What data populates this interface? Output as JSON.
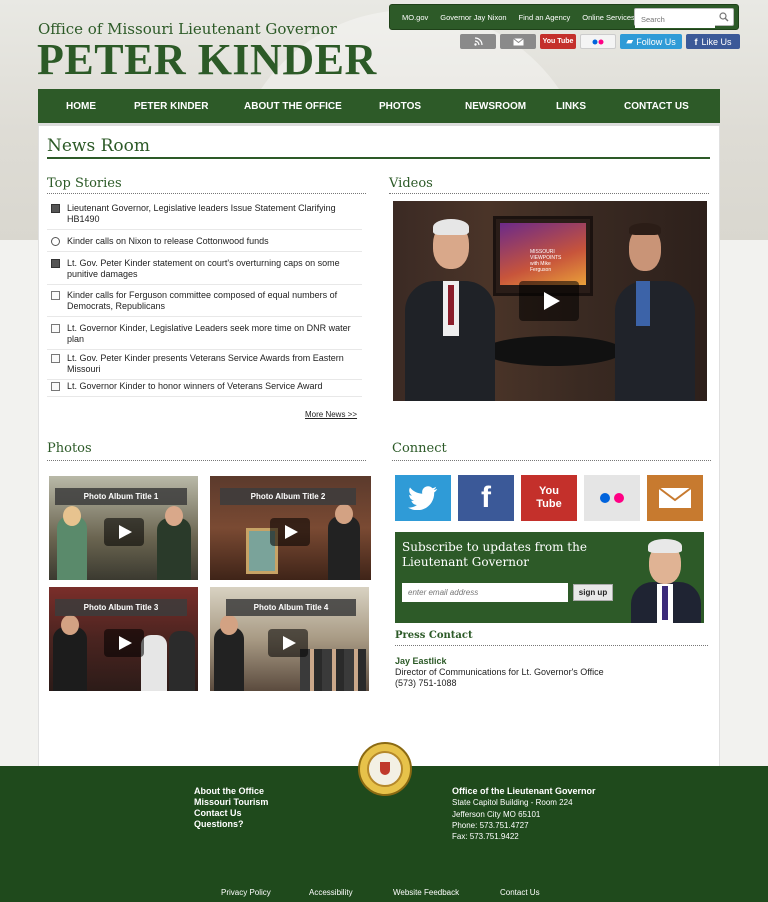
{
  "header": {
    "subtitle": "Office of Missouri Lieutenant Governor",
    "title": "PETER KINDER"
  },
  "util_links": [
    "MO.gov",
    "Governor Jay Nixon",
    "Find an Agency",
    "Online Services"
  ],
  "search": {
    "placeholder": "Search"
  },
  "social": {
    "rss_icon": "rss-icon",
    "email_icon": "email-icon",
    "youtube_label": "You Tube",
    "flickr_icon": "flickr-icon",
    "twitter_label": "Follow Us",
    "facebook_label": "Like Us"
  },
  "nav": [
    "HOME",
    "PETER KINDER",
    "ABOUT THE OFFICE",
    "PHOTOS",
    "NEWSROOM",
    "LINKS",
    "CONTACT US"
  ],
  "page_title": "News Room",
  "top_stories": {
    "heading": "Top Stories",
    "items": [
      {
        "type": "video",
        "text": "Lieutenant Governor, Legislative leaders Issue Statement Clarifying HB1490"
      },
      {
        "type": "audio",
        "text": "Kinder calls on Nixon to release Cottonwood funds"
      },
      {
        "type": "video",
        "text": "Lt. Gov. Peter Kinder statement on court's overturning caps on some punitive damages"
      },
      {
        "type": "document",
        "text": "Kinder calls for Ferguson committee composed of equal numbers of Democrats, Republicans"
      },
      {
        "type": "document",
        "text": "Lt. Governor Kinder, Legislative Leaders seek more time on DNR water plan"
      },
      {
        "type": "document",
        "text": "Lt. Gov. Peter Kinder presents Veterans Service Awards from Eastern Missouri"
      },
      {
        "type": "document",
        "text": "Lt. Governor Kinder to honor winners of Veterans Service Award"
      }
    ],
    "more": "More News >>"
  },
  "videos": {
    "heading": "Videos",
    "video_label": "MISSOURI VIEWPOINTS with Mike Ferguson"
  },
  "photos": {
    "heading": "Photos",
    "albums": [
      "Photo Album Title 1",
      "Photo Album Title 2",
      "Photo Album Title 3",
      "Photo Album Title 4"
    ]
  },
  "connect": {
    "heading": "Connect",
    "tiles": [
      "twitter-icon",
      "facebook-icon",
      "youtube-icon",
      "flickr-icon",
      "email-icon"
    ],
    "youtube_text": "You Tube",
    "subscribe_title": "Subscribe to updates from the Lieutenant Governor",
    "email_placeholder": "enter email address",
    "signup_label": "sign up"
  },
  "press_contact": {
    "heading": "Press Contact",
    "name": "Jay Eastlick",
    "role": "Director of Communications for Lt. Governor's Office",
    "phone": "(573) 751-1088"
  },
  "footer": {
    "links": [
      "About the Office",
      "Missouri Tourism",
      "Contact Us",
      "Questions?"
    ],
    "office_title": "Office of the Lieutenant Governor",
    "address_lines": [
      "State Capitol Building - Room 224",
      "Jefferson City MO 65101",
      "Phone: 573.751.4727",
      "Fax: 573.751.9422"
    ],
    "bottom_links": [
      "Privacy Policy",
      "Accessibility",
      "Website Feedback",
      "Contact Us"
    ]
  },
  "colors": {
    "brand_green": "#2d5a28",
    "footer_green": "#1f4a1c",
    "twitter": "#2f9bd7",
    "facebook": "#3b5998",
    "youtube": "#c4302b",
    "email": "#c77a2f"
  }
}
